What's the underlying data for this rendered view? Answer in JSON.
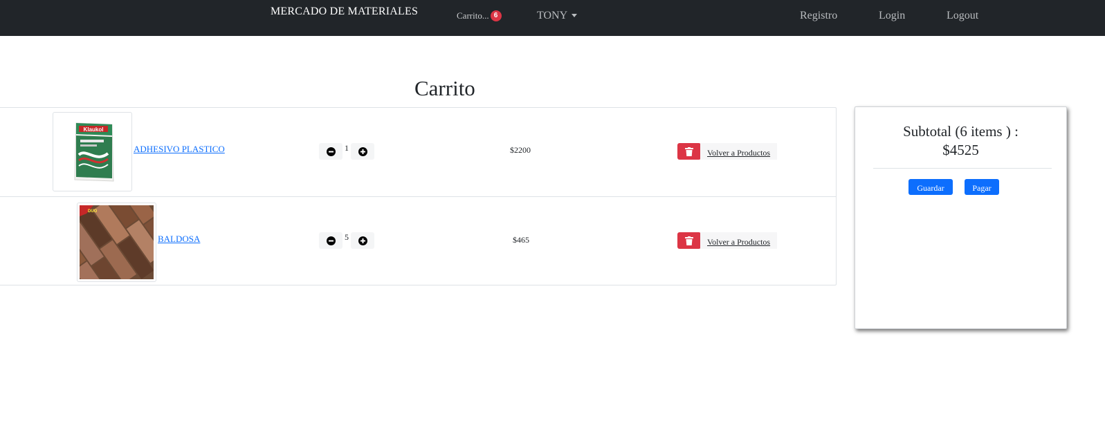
{
  "navbar": {
    "brand": "MERCADO DE MATERIALES",
    "cart_label": "Carrito...",
    "cart_count": "6",
    "user": "TONY",
    "links": [
      "Registro",
      "Login",
      "Logout"
    ]
  },
  "page_title": "Carrito",
  "items": [
    {
      "name": "ADHESIVO PLASTICO",
      "quantity": "1",
      "price": "$2200",
      "back_label": "Volver a Productos"
    },
    {
      "name": "BALDOSA",
      "quantity": "5",
      "price": "$465",
      "back_label": "Volver a Productos"
    }
  ],
  "summary": {
    "title_line1": "Subtotal (6 items ) :",
    "title_line2": "$4525",
    "save_label": "Guardar",
    "pay_label": "Pagar"
  },
  "colors": {
    "navbar_bg": "#212529",
    "badge": "#dc3545",
    "delete": "#dc3545",
    "primary": "#0d6efd",
    "link": "#0d6efd"
  },
  "icons": [
    "minus-circle-icon",
    "plus-circle-icon",
    "trash-icon",
    "caret-down-icon"
  ]
}
